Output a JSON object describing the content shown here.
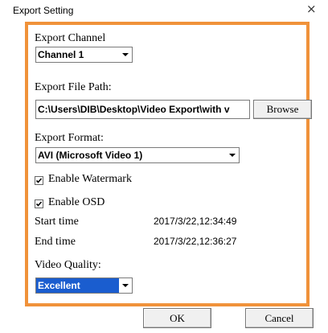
{
  "window": {
    "title": "Export Setting",
    "close_glyph": "×"
  },
  "export_channel": {
    "label": "Export Channel",
    "selected": "Channel 1"
  },
  "export_file_path": {
    "label": "Export File Path:",
    "value": "C:\\Users\\DIB\\Desktop\\Video Export\\with v",
    "browse_label": "Browse"
  },
  "export_format": {
    "label": "Export Format:",
    "selected": "AVI (Microsoft Video 1)"
  },
  "enable_watermark": {
    "label": "Enable Watermark",
    "checked": true
  },
  "enable_osd": {
    "label": "Enable OSD",
    "checked": true
  },
  "start_time": {
    "label": "Start time",
    "value": "2017/3/22,12:34:49"
  },
  "end_time": {
    "label": "End time",
    "value": "2017/3/22,12:36:27"
  },
  "video_quality": {
    "label": "Video Quality:",
    "selected": "Excellent"
  },
  "footer": {
    "ok_label": "OK",
    "cancel_label": "Cancel"
  },
  "colors": {
    "highlight_border": "#f0923a",
    "selection_blue": "#1a5dcf"
  },
  "icons": {
    "dropdown": "chevron-down-icon",
    "checkbox": "check-icon",
    "close": "close-icon"
  }
}
